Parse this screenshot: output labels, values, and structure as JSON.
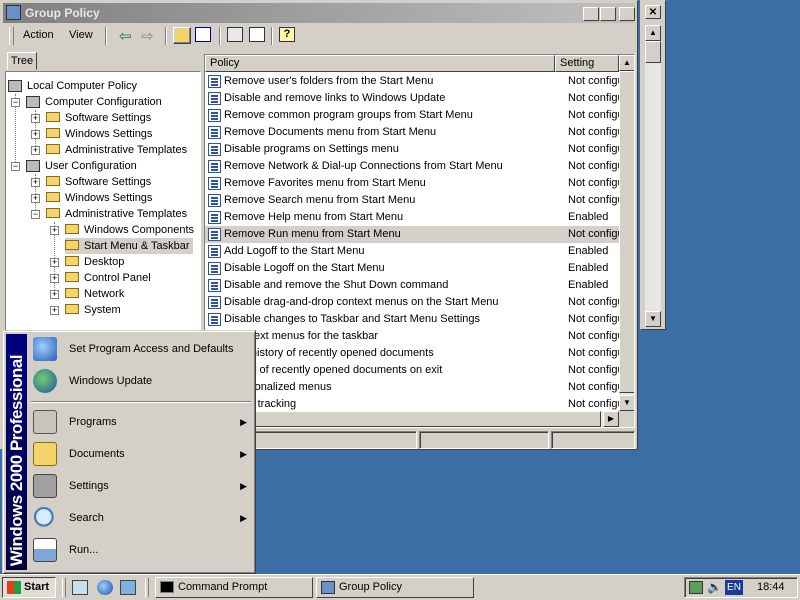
{
  "window": {
    "title": "Group Policy",
    "menu": {
      "action": "Action",
      "view": "View"
    }
  },
  "tree": {
    "tab_label": "Tree",
    "nodes": [
      {
        "label": "Local Computer Policy"
      },
      {
        "label": "Computer Configuration"
      },
      {
        "label": "Software Settings"
      },
      {
        "label": "Windows Settings"
      },
      {
        "label": "Administrative Templates"
      },
      {
        "label": "User Configuration"
      },
      {
        "label": "Software Settings"
      },
      {
        "label": "Windows Settings"
      },
      {
        "label": "Administrative Templates"
      },
      {
        "label": "Windows Components"
      },
      {
        "label": "Start Menu & Taskbar"
      },
      {
        "label": "Desktop"
      },
      {
        "label": "Control Panel"
      },
      {
        "label": "Network"
      },
      {
        "label": "System"
      }
    ]
  },
  "policy_list": {
    "columns": {
      "policy": "Policy",
      "setting": "Setting"
    },
    "rows": [
      {
        "name": "Remove user's folders from the Start Menu",
        "setting": "Not configu"
      },
      {
        "name": "Disable and remove links to Windows Update",
        "setting": "Not configu"
      },
      {
        "name": "Remove common program groups from Start Menu",
        "setting": "Not configu"
      },
      {
        "name": "Remove Documents menu from Start Menu",
        "setting": "Not configu"
      },
      {
        "name": "Disable programs on Settings menu",
        "setting": "Not configu"
      },
      {
        "name": "Remove Network & Dial-up Connections from Start Menu",
        "setting": "Not configu"
      },
      {
        "name": "Remove Favorites menu from Start Menu",
        "setting": "Not configu"
      },
      {
        "name": "Remove Search menu from Start Menu",
        "setting": "Not configu"
      },
      {
        "name": "Remove Help menu from Start Menu",
        "setting": "Enabled"
      },
      {
        "name": "Remove Run menu from Start Menu",
        "setting": "Not configu"
      },
      {
        "name": "Add Logoff to the Start Menu",
        "setting": "Enabled"
      },
      {
        "name": "Disable Logoff on the Start Menu",
        "setting": "Enabled"
      },
      {
        "name": "Disable and remove the Shut Down command",
        "setting": "Enabled"
      },
      {
        "name": "Disable drag-and-drop context menus on the Start Menu",
        "setting": "Not configu"
      },
      {
        "name": "Disable changes to Taskbar and Start Menu Settings",
        "setting": "Not configu"
      },
      {
        "name": "e context menus for the taskbar",
        "setting": "Not configu"
      },
      {
        "name": "keep history of recently opened documents",
        "setting": "Not configu"
      },
      {
        "name": "history of recently opened documents on exit",
        "setting": "Not configu"
      },
      {
        "name": "e personalized menus",
        "setting": "Not configu"
      },
      {
        "name": "e user tracking",
        "setting": "Not configu"
      }
    ]
  },
  "start_menu": {
    "banner": "Windows 2000 Professional",
    "items": [
      {
        "label": "Set Program Access and Defaults",
        "icon": "program-access-icon"
      },
      {
        "label": "Windows Update",
        "icon": "windows-update-icon"
      },
      {
        "label": "Programs",
        "icon": "programs-icon"
      },
      {
        "label": "Documents",
        "icon": "documents-icon"
      },
      {
        "label": "Settings",
        "icon": "settings-icon"
      },
      {
        "label": "Search",
        "icon": "search-icon"
      },
      {
        "label": "Run...",
        "icon": "run-icon"
      }
    ]
  },
  "taskbar": {
    "start_label": "Start",
    "tasks": [
      {
        "label": "Command Prompt"
      },
      {
        "label": "Group Policy"
      }
    ],
    "language": "EN",
    "clock": "18:44"
  },
  "colors": {
    "desktop": "#3a6ea5",
    "face": "#d4d0c8",
    "banner": "#000080"
  }
}
